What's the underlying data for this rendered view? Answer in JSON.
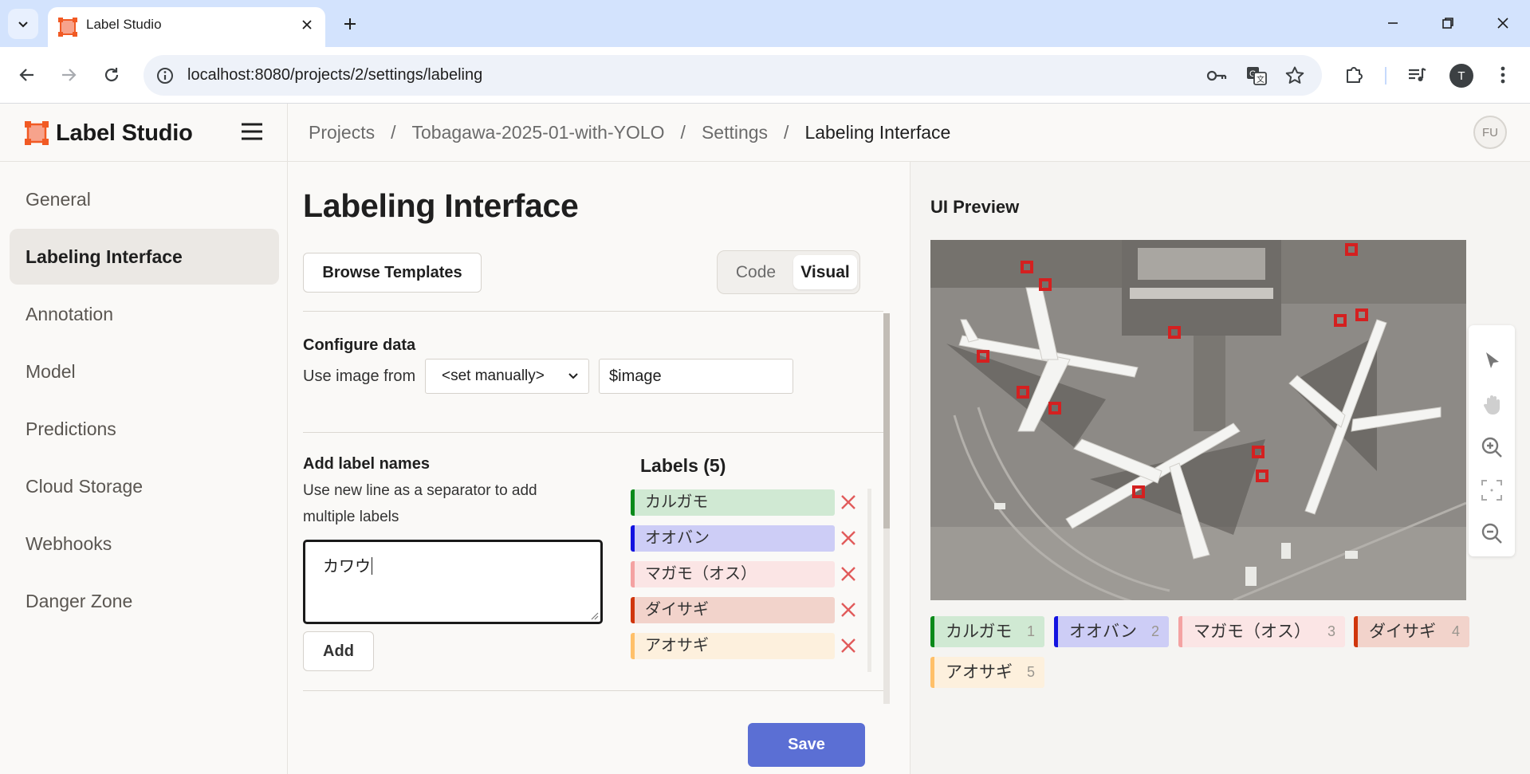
{
  "browser": {
    "tab_title": "Label Studio",
    "url": "localhost:8080/projects/2/settings/labeling",
    "profile_initial": "T"
  },
  "app": {
    "logo_text": "Label Studio",
    "breadcrumb": [
      "Projects",
      "Tobagawa-2025-01-with-YOLO",
      "Settings",
      "Labeling Interface"
    ],
    "avatar_initials": "FU"
  },
  "sidebar": {
    "items": [
      {
        "label": "General"
      },
      {
        "label": "Labeling Interface",
        "active": true
      },
      {
        "label": "Annotation"
      },
      {
        "label": "Model"
      },
      {
        "label": "Predictions"
      },
      {
        "label": "Cloud Storage"
      },
      {
        "label": "Webhooks"
      },
      {
        "label": "Danger Zone"
      }
    ]
  },
  "config": {
    "title": "Labeling Interface",
    "browse_label": "Browse Templates",
    "mode_toggle": {
      "options": [
        "Code",
        "Visual"
      ],
      "selected": "Visual"
    },
    "configure_data": {
      "title": "Configure data",
      "use_image_label": "Use image from",
      "source_select": "<set manually>",
      "variable_value": "$image"
    },
    "add_labels": {
      "title": "Add label names",
      "hint": [
        "Use new line as a separator to add",
        "multiple labels"
      ],
      "textarea_value": "カワウ",
      "add_button": "Add"
    },
    "labels_title": "Labels (5)",
    "save_label": "Save"
  },
  "labels": [
    {
      "name": "カルガモ",
      "color": "#0b8a1a",
      "bg": "#d0e9d3",
      "hotkey": "1"
    },
    {
      "name": "オオバン",
      "color": "#1313e0",
      "bg": "#cdcdf6",
      "hotkey": "2"
    },
    {
      "name": "マガモ（オス）",
      "color": "#f4a2a2",
      "bg": "#fbe5e5",
      "hotkey": "3"
    },
    {
      "name": "ダイサギ",
      "color": "#d0360d",
      "bg": "#f2d3cb",
      "hotkey": "4"
    },
    {
      "name": "アオサギ",
      "color": "#ffc069",
      "bg": "#fdf0dd",
      "hotkey": "5"
    }
  ],
  "preview": {
    "title": "UI Preview"
  },
  "colors": {
    "accent": "#5b6fd4",
    "sidebar_active": "#ebe8e4",
    "brand": "#f15a24",
    "remove_x": "#e15b5b"
  },
  "icons": {
    "tab_menu": "chevron-down-icon",
    "favicon": "label-studio-logo-icon",
    "close_tab": "close-icon",
    "new_tab": "plus-icon",
    "minimize": "minimize-icon",
    "restore": "restore-icon",
    "close_window": "close-icon",
    "back": "arrow-left-icon",
    "forward": "arrow-right-icon",
    "reload": "reload-icon",
    "site_info": "info-icon",
    "password": "key-icon",
    "translate": "translate-icon",
    "bookmark": "star-icon",
    "extensions": "puzzle-icon",
    "media": "media-icon",
    "menu": "kebab-menu-icon",
    "hamburger": "hamburger-icon",
    "remove_label": "close-icon",
    "pointer": "cursor-icon",
    "pan": "hand-icon",
    "zoom_in": "zoom-in-icon",
    "fit": "fit-icon",
    "zoom_out": "zoom-out-icon"
  }
}
